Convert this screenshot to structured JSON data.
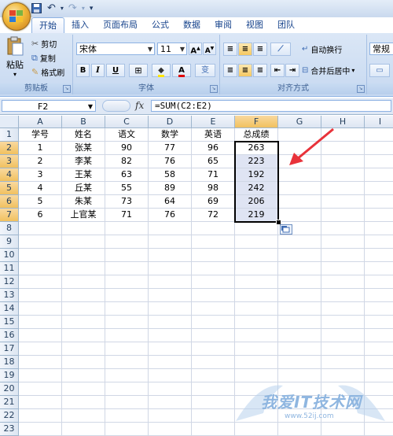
{
  "quick_access": {
    "undo": "↶",
    "redo": "↷",
    "customize": "▾"
  },
  "tabs": [
    {
      "label": "开始",
      "active": true
    },
    {
      "label": "插入"
    },
    {
      "label": "页面布局"
    },
    {
      "label": "公式"
    },
    {
      "label": "数据"
    },
    {
      "label": "审阅"
    },
    {
      "label": "视图"
    },
    {
      "label": "团队"
    }
  ],
  "clipboard": {
    "paste": "粘贴",
    "cut": "剪切",
    "copy": "复制",
    "format_painter": "格式刷",
    "group": "剪贴板"
  },
  "font": {
    "name": "宋体",
    "size": "11",
    "grow": "A",
    "shrink": "A",
    "bold": "B",
    "italic": "I",
    "underline": "U",
    "wen": "变",
    "group": "字体"
  },
  "alignment": {
    "wrap": "自动换行",
    "merge": "合并后居中",
    "group": "对齐方式"
  },
  "number": {
    "format": "常规"
  },
  "formula_bar": {
    "cell": "F2",
    "fx": "fx",
    "formula": "=SUM(C2:E2)"
  },
  "columns": [
    "A",
    "B",
    "C",
    "D",
    "E",
    "F",
    "G",
    "H",
    "I"
  ],
  "rows": [
    "1",
    "2",
    "3",
    "4",
    "5",
    "6",
    "7",
    "8",
    "9",
    "10",
    "11",
    "12",
    "13",
    "14",
    "15",
    "16",
    "17",
    "18",
    "19",
    "20",
    "21",
    "22",
    "23"
  ],
  "table": {
    "header": [
      "学号",
      "姓名",
      "语文",
      "数学",
      "英语",
      "总成绩"
    ],
    "data": [
      [
        "1",
        "张某",
        "90",
        "77",
        "96",
        "263"
      ],
      [
        "2",
        "李某",
        "82",
        "76",
        "65",
        "223"
      ],
      [
        "3",
        "王某",
        "63",
        "58",
        "71",
        "192"
      ],
      [
        "4",
        "丘某",
        "55",
        "89",
        "98",
        "242"
      ],
      [
        "5",
        "朱某",
        "73",
        "64",
        "69",
        "206"
      ],
      [
        "6",
        "上官某",
        "71",
        "76",
        "72",
        "219"
      ]
    ]
  },
  "watermark": {
    "text": "我爱IT技术网",
    "url": "www.52ij.com"
  },
  "colors": {
    "accent": "#15428b",
    "selection": "#dfe4f3",
    "header_selected": "#f1c15f",
    "arrow": "#e8323a"
  }
}
